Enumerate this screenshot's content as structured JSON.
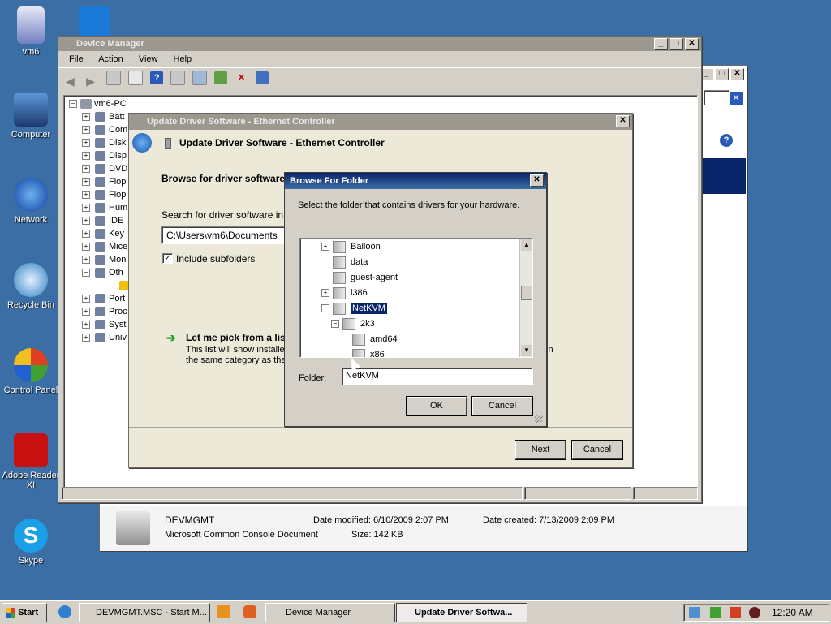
{
  "desktop": {
    "icons": [
      {
        "label": "vm6",
        "icon": "user-folder-icon"
      },
      {
        "label": "Computer",
        "icon": "computer-icon"
      },
      {
        "label": "Network",
        "icon": "network-icon"
      },
      {
        "label": "Recycle Bin",
        "icon": "recycle-bin-icon"
      },
      {
        "label": "Control Panel",
        "icon": "control-panel-icon"
      },
      {
        "label": "Adobe Reader XI",
        "icon": "adobe-reader-icon"
      },
      {
        "label": "Skype",
        "icon": "skype-icon"
      }
    ]
  },
  "device_manager": {
    "title": "Device Manager",
    "menu": [
      "File",
      "Action",
      "View",
      "Help"
    ],
    "root": "vm6-PC",
    "tree": [
      "Batt",
      "Com",
      "Disk",
      "Disp",
      "DVD",
      "Flop",
      "Flop",
      "Hum",
      "IDE",
      "Key",
      "Mice",
      "Mon",
      "Oth",
      "",
      "Port",
      "Proc",
      "Syst",
      "Univ"
    ]
  },
  "explorer_details": {
    "name": "DEVMGMT",
    "type": "Microsoft Common Console Document",
    "date_modified": "Date modified: 6/10/2009 2:07 PM",
    "date_created": "Date created: 7/13/2009 2:09 PM",
    "size": "Size: 142 KB"
  },
  "update_driver": {
    "title": "Update Driver Software - Ethernet Controller",
    "header": "Update Driver Software - Ethernet Controller",
    "browse_heading": "Browse for driver software",
    "search_label": "Search for driver software in",
    "path_value": "C:\\Users\\vm6\\Documents",
    "include_subfolders": "Include subfolders",
    "pick_heading": "Let me pick from a lis",
    "pick_desc_1": "This list will show installed",
    "pick_desc_2": "the same category as the",
    "pick_desc_tail": "in",
    "next": "Next",
    "cancel": "Cancel"
  },
  "browse_folder": {
    "title": "Browse For Folder",
    "instruction": "Select the folder that contains drivers for your hardware.",
    "tree": [
      {
        "label": "Balloon",
        "expander": "+",
        "level": 0
      },
      {
        "label": "data",
        "expander": "",
        "level": 0
      },
      {
        "label": "guest-agent",
        "expander": "",
        "level": 0
      },
      {
        "label": "i386",
        "expander": "+",
        "level": 0
      },
      {
        "label": "NetKVM",
        "expander": "−",
        "level": 0,
        "selected": true
      },
      {
        "label": "2k3",
        "expander": "−",
        "level": 1
      },
      {
        "label": "amd64",
        "expander": "",
        "level": 2
      },
      {
        "label": "x86",
        "expander": "",
        "level": 2
      }
    ],
    "folder_label": "Folder:",
    "folder_value": "NetKVM",
    "ok": "OK",
    "cancel": "Cancel"
  },
  "taskbar": {
    "start": "Start",
    "buttons": [
      "DEVMGMT.MSC - Start M...",
      "Device Manager",
      "Update Driver Softwa..."
    ],
    "clock": "12:20 AM"
  },
  "colors": {
    "desktop": "#3a6ea5",
    "titlebar_active": "#0a246a",
    "selection": "#0a246a"
  }
}
